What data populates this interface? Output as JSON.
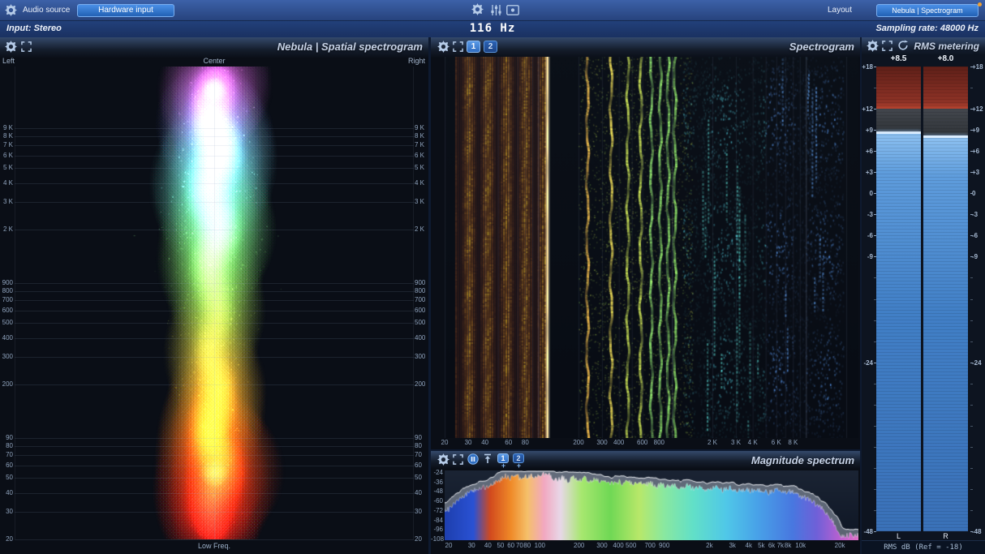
{
  "topbar": {
    "audio_source_label": "Audio source",
    "hardware_input_button": "Hardware input",
    "layout_button": "Layout",
    "preset_button": "Nebula | Spectrogram",
    "frequency_readout": "116 Hz",
    "input_label": "Input: Stereo",
    "sampling_rate_label": "Sampling rate: 48000 Hz"
  },
  "panels": {
    "spatial": {
      "title": "Nebula | Spatial spectrogram",
      "left_label": "Left",
      "center_label": "Center",
      "right_label": "Right",
      "bottom_label": "Low Freq.",
      "freq_ticks": [
        {
          "v": 9000,
          "label": "9 K"
        },
        {
          "v": 8000,
          "label": "8 K"
        },
        {
          "v": 7000,
          "label": "7 K"
        },
        {
          "v": 6000,
          "label": "6 K"
        },
        {
          "v": 5000,
          "label": "5 K"
        },
        {
          "v": 4000,
          "label": "4 K"
        },
        {
          "v": 3000,
          "label": "3 K"
        },
        {
          "v": 2000,
          "label": "2 K"
        },
        {
          "v": 900,
          "label": "900"
        },
        {
          "v": 800,
          "label": "800"
        },
        {
          "v": 700,
          "label": "700"
        },
        {
          "v": 600,
          "label": "600"
        },
        {
          "v": 500,
          "label": "500"
        },
        {
          "v": 400,
          "label": "400"
        },
        {
          "v": 300,
          "label": "300"
        },
        {
          "v": 200,
          "label": "200"
        },
        {
          "v": 90,
          "label": "90"
        },
        {
          "v": 80,
          "label": "80"
        },
        {
          "v": 70,
          "label": "70"
        },
        {
          "v": 60,
          "label": "60"
        },
        {
          "v": 50,
          "label": "50"
        },
        {
          "v": 40,
          "label": "40"
        },
        {
          "v": 30,
          "label": "30"
        },
        {
          "v": 20,
          "label": "20"
        }
      ]
    },
    "spectrogram": {
      "title": "Spectrogram",
      "view_buttons": [
        "1",
        "2"
      ],
      "freq_ticks": [
        {
          "v": 20,
          "label": "20"
        },
        {
          "v": 30,
          "label": "30"
        },
        {
          "v": 40,
          "label": "40"
        },
        {
          "v": 60,
          "label": "60"
        },
        {
          "v": 80,
          "label": "80"
        },
        {
          "v": 200,
          "label": "200"
        },
        {
          "v": 300,
          "label": "300"
        },
        {
          "v": 400,
          "label": "400"
        },
        {
          "v": 600,
          "label": "600"
        },
        {
          "v": 800,
          "label": "800"
        },
        {
          "v": 2000,
          "label": "2 K"
        },
        {
          "v": 3000,
          "label": "3 K"
        },
        {
          "v": 4000,
          "label": "4 K"
        },
        {
          "v": 6000,
          "label": "6 K"
        },
        {
          "v": 8000,
          "label": "8 K"
        }
      ]
    },
    "magnitude": {
      "title": "Magnitude spectrum",
      "view_buttons": [
        "1",
        "2"
      ],
      "add_button": "+",
      "db_ticks": [
        "-24",
        "-36",
        "-48",
        "-60",
        "-72",
        "-84",
        "-96",
        "-108"
      ],
      "freq_ticks": [
        {
          "v": 20,
          "label": "20"
        },
        {
          "v": 30,
          "label": "30"
        },
        {
          "v": 40,
          "label": "40"
        },
        {
          "v": 50,
          "label": "50"
        },
        {
          "v": 60,
          "label": "60"
        },
        {
          "v": 70,
          "label": "70"
        },
        {
          "v": 80,
          "label": "80"
        },
        {
          "v": 100,
          "label": "100"
        },
        {
          "v": 200,
          "label": "200"
        },
        {
          "v": 300,
          "label": "300"
        },
        {
          "v": 400,
          "label": "400"
        },
        {
          "v": 500,
          "label": "500"
        },
        {
          "v": 700,
          "label": "700"
        },
        {
          "v": 900,
          "label": "900"
        },
        {
          "v": 2000,
          "label": "2k"
        },
        {
          "v": 3000,
          "label": "3k"
        },
        {
          "v": 4000,
          "label": "4k"
        },
        {
          "v": 5000,
          "label": "5k"
        },
        {
          "v": 6000,
          "label": "6k"
        },
        {
          "v": 7000,
          "label": "7k"
        },
        {
          "v": 8000,
          "label": "8k"
        },
        {
          "v": 10000,
          "label": "10k"
        },
        {
          "v": 20000,
          "label": "20k"
        }
      ]
    },
    "rms": {
      "title": "RMS metering",
      "footer": "RMS dB (Ref = -18)",
      "scale_ticks": [
        {
          "v": 18,
          "label": "+18"
        },
        {
          "v": 12,
          "label": "+12"
        },
        {
          "v": 9,
          "label": "+9"
        },
        {
          "v": 6,
          "label": "+6"
        },
        {
          "v": 3,
          "label": "+3"
        },
        {
          "v": 0,
          "label": "0"
        },
        {
          "v": -3,
          "label": "-3"
        },
        {
          "v": -6,
          "label": "-6"
        },
        {
          "v": -9,
          "label": "-9"
        },
        {
          "v": -24,
          "label": "-24"
        },
        {
          "v": -48,
          "label": "-48"
        }
      ],
      "minor_ticks": [
        15,
        -12,
        -15,
        -18,
        -21,
        -27,
        -30,
        -33,
        -36,
        -39,
        -42,
        -45
      ],
      "channels": [
        {
          "label": "L",
          "value_label": "+8.5",
          "value": 8.5
        },
        {
          "label": "R",
          "value_label": "+8.0",
          "value": 8.0
        }
      ]
    }
  },
  "colors": {
    "accent_blue": "#2f7fe0",
    "meter_red": "#8e3226",
    "meter_gray": "#43474e",
    "meter_blue": "#417fc6"
  },
  "chart_data": [
    {
      "type": "heatmap",
      "title": "Nebula | Spatial spectrogram",
      "x_axis": [
        "Left",
        "Center",
        "Right"
      ],
      "y_axis_hz_range": [
        20,
        10000
      ],
      "description": "Vertical rainbow energy column centered on the stereo Center: magenta/blue/cyan at high frequencies, green-yellow mids, bright orange-red energy at 20-100 Hz"
    },
    {
      "type": "heatmap",
      "title": "Spectrogram",
      "x_axis_hz_range": [
        20,
        24000
      ],
      "fundamental_hz": 116,
      "description": "Time scrolls vertically; strong orange bands 25-110 Hz, bright line at 116 Hz, wavy yellow-green harmonic traces 200-1000 Hz, sparse cyan/blue speckles 1.2k-20k"
    },
    {
      "type": "area",
      "title": "Magnitude spectrum",
      "ylim": [
        -108,
        -24
      ],
      "xlim_hz": [
        20,
        20000
      ],
      "points": [
        [
          20,
          -72
        ],
        [
          24,
          -58
        ],
        [
          28,
          -50
        ],
        [
          32,
          -46
        ],
        [
          36,
          -44
        ],
        [
          40,
          -42
        ],
        [
          45,
          -38
        ],
        [
          50,
          -34
        ],
        [
          55,
          -29
        ],
        [
          60,
          -32
        ],
        [
          65,
          -27
        ],
        [
          70,
          -32
        ],
        [
          75,
          -29
        ],
        [
          80,
          -31
        ],
        [
          85,
          -28
        ],
        [
          90,
          -33
        ],
        [
          95,
          -30
        ],
        [
          100,
          -28
        ],
        [
          110,
          -26
        ],
        [
          116,
          -25
        ],
        [
          125,
          -31
        ],
        [
          135,
          -34
        ],
        [
          150,
          -31
        ],
        [
          165,
          -35
        ],
        [
          180,
          -31
        ],
        [
          200,
          -36
        ],
        [
          220,
          -32
        ],
        [
          240,
          -36
        ],
        [
          260,
          -33
        ],
        [
          290,
          -37
        ],
        [
          320,
          -34
        ],
        [
          350,
          -38
        ],
        [
          390,
          -35
        ],
        [
          430,
          -39
        ],
        [
          470,
          -36
        ],
        [
          520,
          -40
        ],
        [
          570,
          -37
        ],
        [
          630,
          -41
        ],
        [
          700,
          -38
        ],
        [
          780,
          -42
        ],
        [
          860,
          -39
        ],
        [
          950,
          -43
        ],
        [
          1050,
          -40
        ],
        [
          1200,
          -44
        ],
        [
          1350,
          -41
        ],
        [
          1500,
          -45
        ],
        [
          1700,
          -42
        ],
        [
          1900,
          -46
        ],
        [
          2200,
          -43
        ],
        [
          2500,
          -47
        ],
        [
          2900,
          -44
        ],
        [
          3300,
          -48
        ],
        [
          3800,
          -45
        ],
        [
          4400,
          -49
        ],
        [
          5000,
          -46
        ],
        [
          5700,
          -50
        ],
        [
          6500,
          -47
        ],
        [
          7400,
          -51
        ],
        [
          8400,
          -48
        ],
        [
          9500,
          -53
        ],
        [
          11000,
          -57
        ],
        [
          13000,
          -64
        ],
        [
          15000,
          -72
        ],
        [
          17000,
          -82
        ],
        [
          19000,
          -95
        ],
        [
          20000,
          -104
        ]
      ],
      "gradient": [
        [
          0.0,
          "#1e3fae"
        ],
        [
          0.07,
          "#2a52d4"
        ],
        [
          0.11,
          "#d24a1e"
        ],
        [
          0.16,
          "#f08a28"
        ],
        [
          0.2,
          "#f5c06a"
        ],
        [
          0.24,
          "#f2a8c0"
        ],
        [
          0.28,
          "#e8d8e8"
        ],
        [
          0.33,
          "#a8e870"
        ],
        [
          0.4,
          "#70d855"
        ],
        [
          0.47,
          "#b8e86a"
        ],
        [
          0.53,
          "#8ae8a0"
        ],
        [
          0.6,
          "#62e0c8"
        ],
        [
          0.68,
          "#50c8e8"
        ],
        [
          0.76,
          "#48a0e8"
        ],
        [
          0.84,
          "#4878e0"
        ],
        [
          0.9,
          "#7060d8"
        ],
        [
          0.96,
          "#c060d0"
        ],
        [
          1.0,
          "#e070c8"
        ]
      ]
    },
    {
      "type": "meter",
      "title": "RMS metering",
      "unit": "dB RMS",
      "ref_db": -18,
      "scale": [
        -48,
        18
      ],
      "channels": [
        {
          "name": "L",
          "value": 8.5
        },
        {
          "name": "R",
          "value": 8.0
        }
      ]
    }
  ]
}
